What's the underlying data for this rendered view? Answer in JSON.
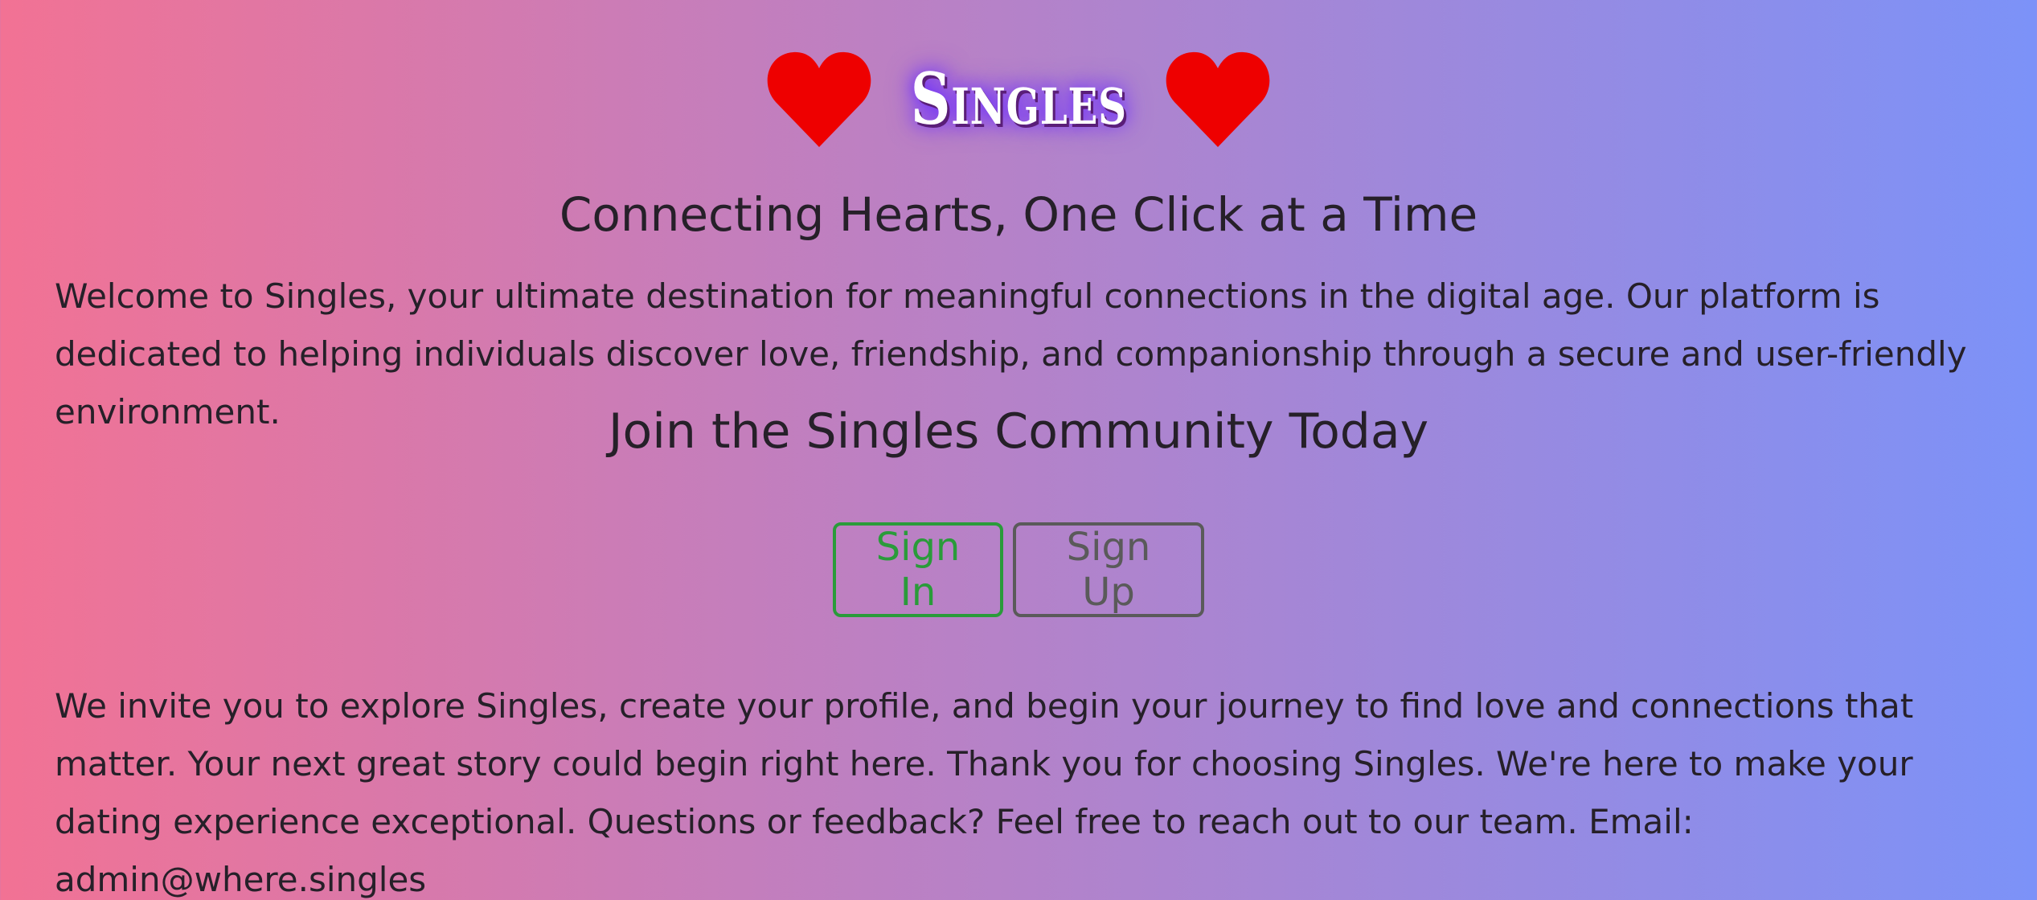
{
  "brand": {
    "name": "Singles",
    "heart_color": "#ee0000",
    "glow_color": "#6b2cff"
  },
  "icons": {
    "left": "heart-icon",
    "right": "heart-icon"
  },
  "tagline": "Connecting Hearts, One Click at a Time",
  "intro": "Welcome to Singles, your ultimate destination for meaningful connections in the digital age. Our platform is dedicated to helping individuals discover love, friendship, and companionship through a secure and user-friendly environment.",
  "join_heading": "Join the Singles Community Today",
  "buttons": {
    "sign_in": "Sign In",
    "sign_up": "Sign Up"
  },
  "colors": {
    "gradient_start": "#f27294",
    "gradient_end": "#7c92f8",
    "sign_in": "#2a9b3a",
    "sign_up": "#5a5a5a"
  },
  "outro": "We invite you to explore Singles, create your profile, and begin your journey to find love and connections that matter. Your next great story could begin right here. Thank you for choosing Singles. We're here to make your dating experience exceptional. Questions or feedback? Feel free to reach out to our team. Email: admin@where.singles"
}
